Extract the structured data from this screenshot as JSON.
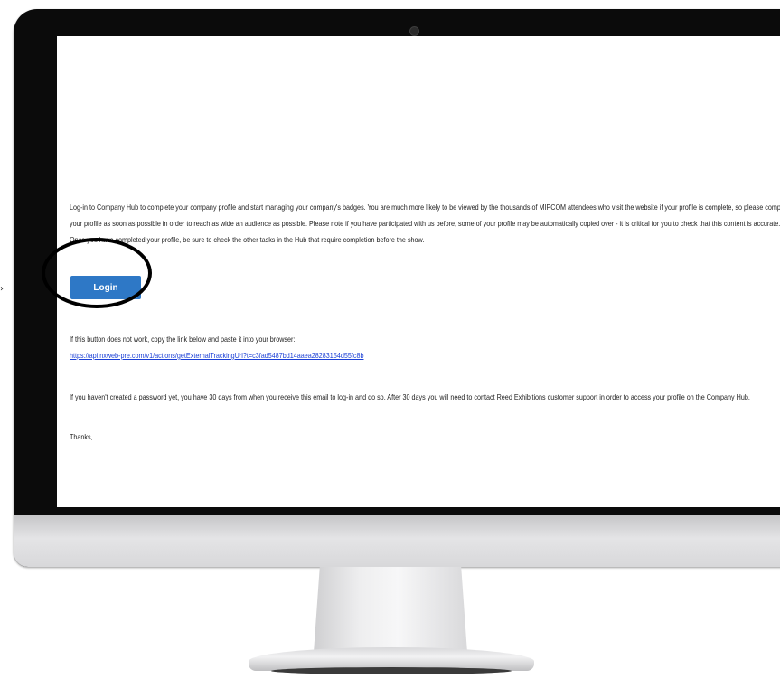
{
  "email": {
    "paragraph_1": "Log-in to Company Hub to complete your company profile and start managing your company's badges. You are much more likely to be viewed by the thousands of MIPCOM attendees who visit the website if your profile is complete, so please complete your profile as soon as possible in order to reach as wide an audience as possible. Please note if you have participated with us before, some of your profile may be automatically copied over - it is critical for you to check that this content is accurate. Once you have completed your profile, be sure to check the other tasks in the Hub that require completion before the show.",
    "login_label": "Login",
    "fallback_intro": "If this button does not work, copy the link below and paste it into your browser:",
    "tracking_link": "https://api.nxweb-pre.com/v1/actions/getExternalTrackingUrl?t=c3fad5487bd14aaea28283154d55fc8b",
    "password_note": "If you haven't created a password yet, you have 30 days from when you receive this email to log-in and do so. After 30 days you will need to contact Reed Exhibitions customer support in order to access your profile on the Company Hub.",
    "signoff": "Thanks,"
  },
  "icons": {
    "arrow": "arrow-right-icon",
    "highlight": "highlight-circle"
  },
  "colors": {
    "button": "#2e78c6",
    "link": "#1a3fd6",
    "bezel": "#0b0b0b"
  }
}
